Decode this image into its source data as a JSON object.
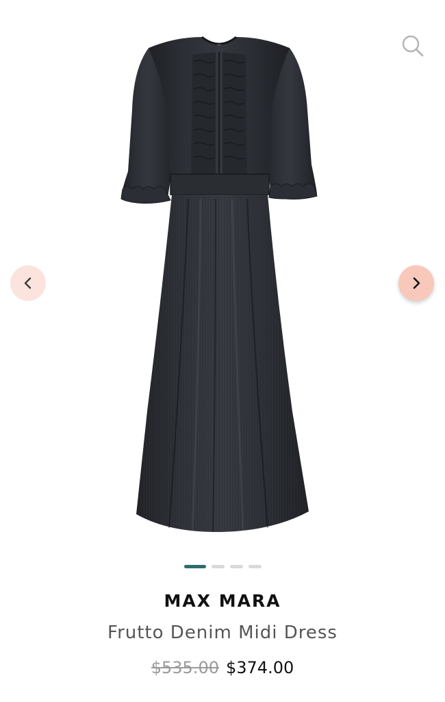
{
  "header": {
    "search_icon": "search-icon"
  },
  "gallery": {
    "image_alt": "Frutto Denim Midi Dress",
    "prev_icon": "chevron-left-icon",
    "next_icon": "chevron-right-icon",
    "slide_count": 4,
    "active_slide": 1,
    "colors": {
      "accent_dot": "#2f6b6e",
      "inactive_dot": "#d9d9d9",
      "nav_prev_bg": "#fbe4dd",
      "nav_next_bg": "#f8c8bb"
    }
  },
  "product": {
    "brand": "MAX MARA",
    "name": "Frutto Denim Midi Dress",
    "original_price": "$535.00",
    "sale_price": "$374.00"
  }
}
